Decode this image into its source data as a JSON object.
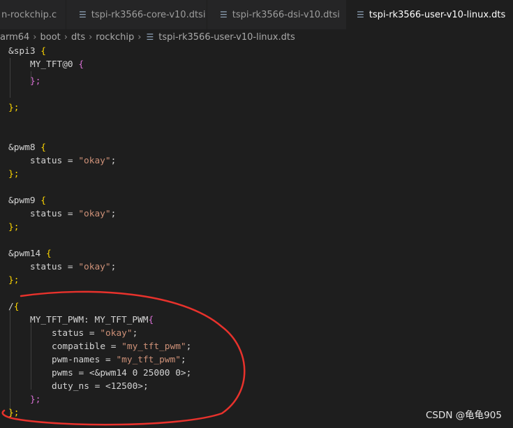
{
  "tabs": [
    {
      "label": "n-rockchip.c",
      "icon": "file-icon",
      "active": false
    },
    {
      "label": "tspi-rk3566-core-v10.dtsi",
      "icon": "list-file-icon",
      "active": false
    },
    {
      "label": "tspi-rk3566-dsi-v10.dtsi",
      "icon": "list-file-icon",
      "active": false
    },
    {
      "label": "tspi-rk3566-user-v10-linux.dts",
      "icon": "list-file-icon",
      "active": true,
      "close": "✕"
    }
  ],
  "breadcrumb": [
    "arm64",
    "boot",
    "dts",
    "rockchip",
    "tspi-rk3566-user-v10-linux.dts"
  ],
  "code": {
    "l1_a": "&spi3 ",
    "l1_b": "{",
    "l2_a": "MY_TFT@0 ",
    "l2_b": "{",
    "l4": "};",
    "l6": "};",
    "l9_a": "&pwm8 ",
    "l9_b": "{",
    "l10_a": "status = ",
    "l10_b": "\"okay\"",
    "l10_c": ";",
    "l11": "};",
    "l13_a": "&pwm9 ",
    "l13_b": "{",
    "l14_a": "status = ",
    "l14_b": "\"okay\"",
    "l14_c": ";",
    "l15": "};",
    "l17_a": "&pwm14 ",
    "l17_b": "{",
    "l18_a": "status = ",
    "l18_b": "\"okay\"",
    "l18_c": ";",
    "l19": "};",
    "l21_a": "/",
    "l21_b": "{",
    "l22_a": "MY_TFT_PWM: MY_TFT_PWM",
    "l22_b": "{",
    "l23_a": "status = ",
    "l23_b": "\"okay\"",
    "l23_c": ";",
    "l24_a": "compatible = ",
    "l24_b": "\"my_tft_pwm\"",
    "l24_c": ";",
    "l25_a": "pwm-names = ",
    "l25_b": "\"my_tft_pwm\"",
    "l25_c": ";",
    "l26": "pwms = <&pwm14 0 25000 0>;",
    "l27": "duty_ns = <12500>;",
    "l28": "};",
    "l29": "};"
  },
  "watermark": "CSDN @龟龟905",
  "colors": {
    "annotation": "#e8322c",
    "string": "#ce9178",
    "bracket_level1": "#ffd700",
    "bracket_level2": "#da70d6"
  }
}
